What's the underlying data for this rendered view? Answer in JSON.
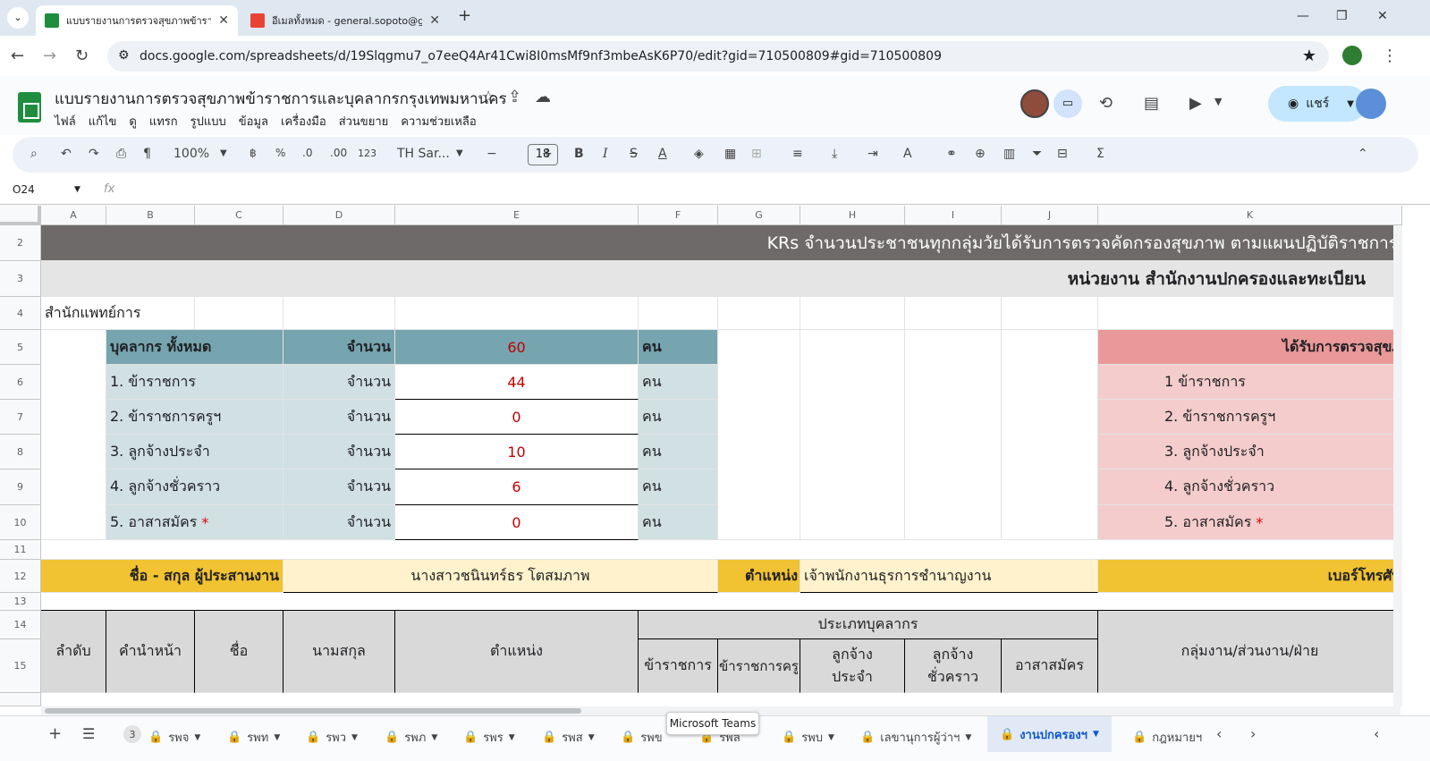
{
  "browser": {
    "tabs": [
      {
        "title": "แบบรายงานการตรวจสุขภาพข้าราช",
        "active": true
      },
      {
        "title": "อีเมลทั้งหมด - general.sopoto@g",
        "active": false
      }
    ],
    "url": "docs.google.com/spreadsheets/d/19Slqgmu7_o7eeQ4Ar41Cwi8I0msMf9nf3mbeAsK6P70/edit?gid=710500809#gid=710500809"
  },
  "doc": {
    "title": "แบบรายงานการตรวจสุขภาพข้าราชการและบุคลากรกรุงเทพมหานคร",
    "menu": [
      "ไฟล์",
      "แก้ไข",
      "ดู",
      "แทรก",
      "รูปแบบ",
      "ข้อมูล",
      "เครื่องมือ",
      "ส่วนขยาย",
      "ความช่วยเหลือ"
    ],
    "share_label": "แชร์"
  },
  "toolbar": {
    "zoom": "100%",
    "baht": "฿",
    "percent": "%",
    "dec_less": ".0",
    "dec_more": ".00",
    "num_format": "123",
    "font": "TH Sar...",
    "font_size": "18"
  },
  "formula": {
    "cell_ref": "O24",
    "fx": "fx"
  },
  "columns": [
    "A",
    "B",
    "C",
    "D",
    "E",
    "F",
    "G",
    "H",
    "I",
    "J",
    "K"
  ],
  "rows": [
    "2",
    "3",
    "4",
    "5",
    "6",
    "7",
    "8",
    "9",
    "10",
    "11",
    "12",
    "13",
    "14",
    "15"
  ],
  "sheet": {
    "r2_title": "KRs จำนวนประชาชนทุกกลุ่มวัยได้รับการตรวจคัดกรองสุขภาพ ตามแผนปฏิบัติราชการ",
    "r3_unit": "หน่วยงาน สำนักงานปกครองและทะเบียน",
    "r4_dept": "สำนักแพทย์การ",
    "r5": {
      "label": "บุคลากร ทั้งหมด",
      "count_label": "จำนวน",
      "value": "60",
      "unit": "คน",
      "right": "ได้รับการตรวจสุขภ"
    },
    "r6": {
      "label": "1. ข้าราชการ",
      "count_label": "จำนวน",
      "value": "44",
      "unit": "คน",
      "right": "1 ข้าราชการ"
    },
    "r7": {
      "label": "2. ข้าราชการครูฯ",
      "count_label": "จำนวน",
      "value": "0",
      "unit": "คน",
      "right": "2. ข้าราชการครูฯ"
    },
    "r8": {
      "label": "3. ลูกจ้างประจำ",
      "count_label": "จำนวน",
      "value": "10",
      "unit": "คน",
      "right": "3. ลูกจ้างประจำ"
    },
    "r9": {
      "label": "4. ลูกจ้างชั่วคราว",
      "count_label": "จำนวน",
      "value": "6",
      "unit": "คน",
      "right": "4. ลูกจ้างชั่วคราว"
    },
    "r10": {
      "label": "5. อาสาสมัคร",
      "asterisk": "*",
      "count_label": "จำนวน",
      "value": "0",
      "unit": "คน",
      "right": "5. อาสาสมัคร"
    },
    "r12": {
      "coord_label": "ชื่อ - สกุล ผู้ประสานงาน",
      "coord_name": "นางสาวชนินทร์ธร  โตสมภาพ",
      "pos_label": "ตำแหน่ง",
      "pos_value": "เจ้าพนักงานธุรการชำนาญงาน",
      "phone_label": "เบอร์โทรศัพ"
    },
    "r14": {
      "seq": "ลำดับ",
      "prefix": "คำนำหน้า",
      "name": "ชื่อ",
      "surname": "นามสกุล",
      "position": "ตำแหน่ง",
      "type": "ประเภทบุคลากร",
      "group": "กลุ่มงาน/ส่วนงาน/ฝ่าย"
    },
    "r15": {
      "t1": "ข้าราชการ",
      "t2": "ข้าราชการครู",
      "t3a": "ลูกจ้าง",
      "t3b": "ประจำ",
      "t4a": "ลูกจ้าง",
      "t4b": "ชั่วคราว",
      "t5": "อาสาสมัคร"
    }
  },
  "sheet_tabs": {
    "count_badge": "3",
    "tabs": [
      "รพจ",
      "รพท",
      "รพว",
      "รพภ",
      "รพร",
      "รพส",
      "รพข",
      "รพล",
      "รพบ",
      "เลขานุการผู้ว่าฯ",
      "งานปกครองฯ",
      "กฎหมายฯ"
    ],
    "active": "งานปกครองฯ"
  },
  "tooltip": "Microsoft Teams",
  "colors": {
    "dark_band": "#6f6a6a",
    "teal_header": "#76a5af",
    "teal_light": "#d0e0e3",
    "pink_header": "#ea9999",
    "pink_light": "#f4cccc",
    "gold": "#f1c232",
    "cream": "#fff2cc",
    "gray_header": "#d9d9d9"
  }
}
